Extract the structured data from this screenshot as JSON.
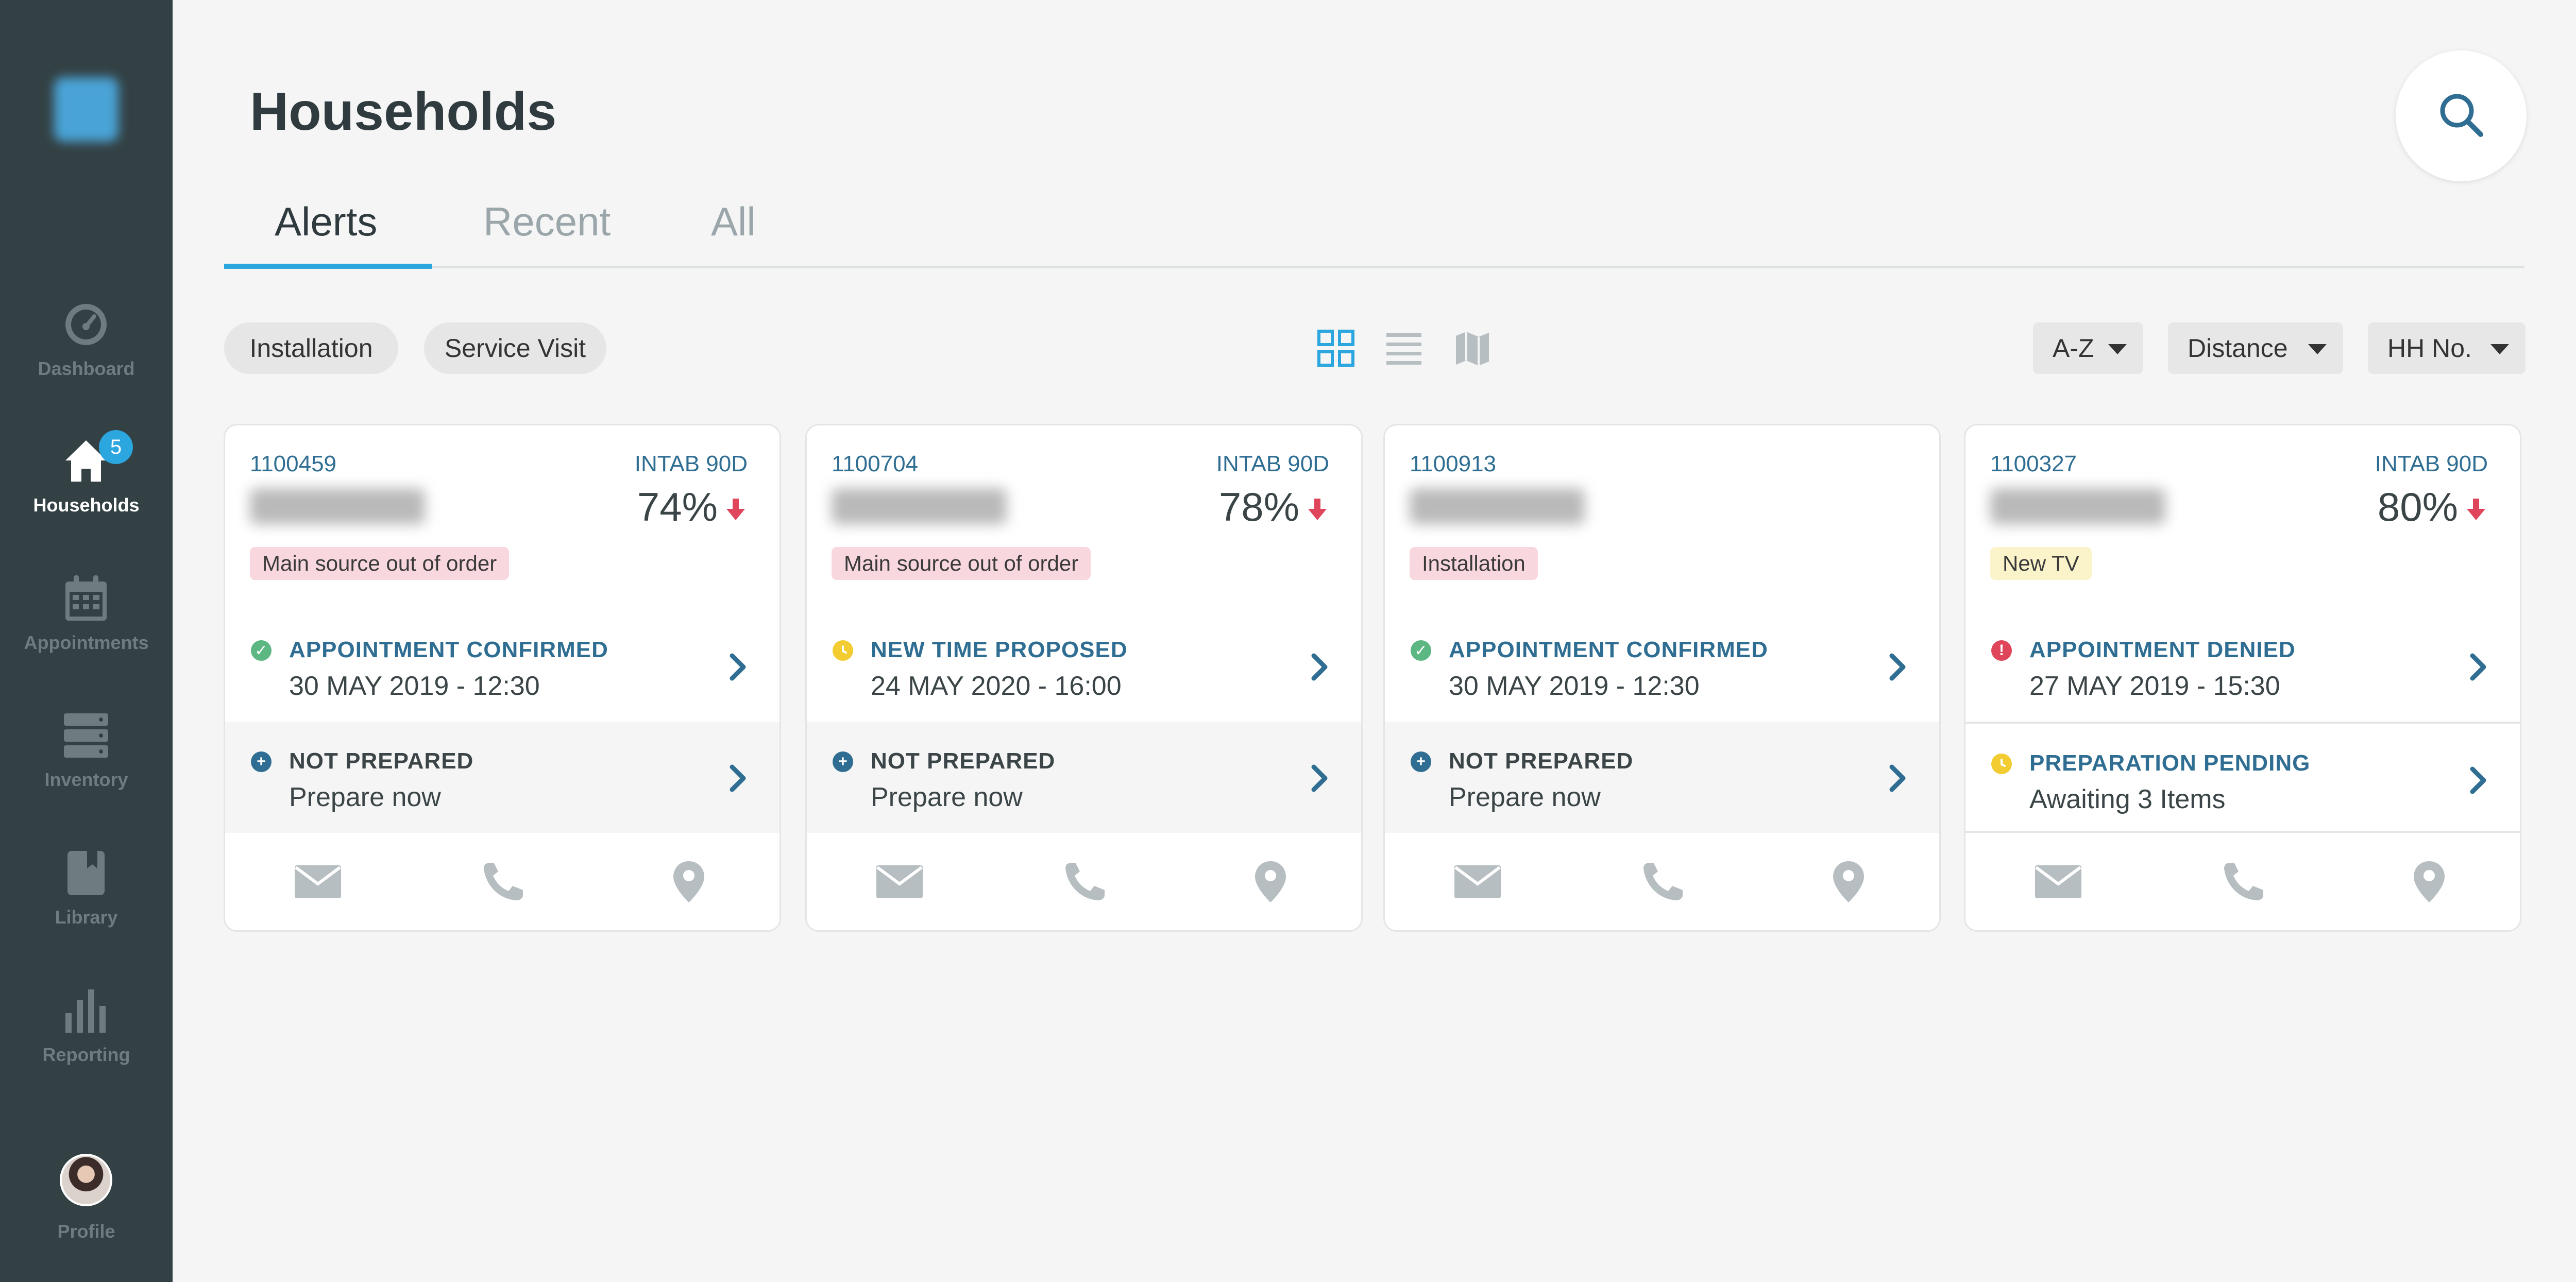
{
  "nav": {
    "items": [
      {
        "label": "Dashboard",
        "icon": "dashboard-icon"
      },
      {
        "label": "Households",
        "icon": "home-icon",
        "badge": "5"
      },
      {
        "label": "Appointments",
        "icon": "calendar-icon"
      },
      {
        "label": "Inventory",
        "icon": "inventory-icon"
      },
      {
        "label": "Library",
        "icon": "book-icon"
      },
      {
        "label": "Reporting",
        "icon": "bar-chart-icon"
      }
    ],
    "profile_label": "Profile"
  },
  "header": {
    "title": "Households"
  },
  "tabs": [
    {
      "label": "Alerts"
    },
    {
      "label": "Recent"
    },
    {
      "label": "All"
    }
  ],
  "filters": {
    "chips": [
      "Installation",
      "Service Visit"
    ],
    "sort": [
      "A-Z",
      "Distance",
      "HH No."
    ]
  },
  "colors": {
    "accent": "#2ba6de",
    "sidebar": "#334144",
    "link_blue": "#2f6e92",
    "confirmed_green": "#5db783",
    "pending_yellow": "#f2cc30",
    "denied_red": "#e0465b",
    "down_arrow": "#e0465b"
  },
  "cards": [
    {
      "id": "1100459",
      "intab": "INTAB 90D",
      "percent": "74%",
      "tag": "Main source out of order",
      "appointment": {
        "status": "APPOINTMENT CONFIRMED",
        "date": "30 MAY 2019 - 12:30"
      },
      "preparation": {
        "status": "NOT PREPARED",
        "detail": "Prepare now"
      }
    },
    {
      "id": "1100704",
      "intab": "INTAB 90D",
      "percent": "78%",
      "tag": "Main source out of order",
      "appointment": {
        "status": "NEW TIME PROPOSED",
        "date": "24 MAY 2020 - 16:00"
      },
      "preparation": {
        "status": "NOT PREPARED",
        "detail": "Prepare now"
      }
    },
    {
      "id": "1100913",
      "tag": "Installation",
      "appointment": {
        "status": "APPOINTMENT CONFIRMED",
        "date": "30 MAY 2019 - 12:30"
      },
      "preparation": {
        "status": "NOT PREPARED",
        "detail": "Prepare now"
      }
    },
    {
      "id": "1100327",
      "intab": "INTAB 90D",
      "percent": "80%",
      "tag": "New TV",
      "appointment": {
        "status": "APPOINTMENT DENIED",
        "date": "27 MAY 2019 - 15:30"
      },
      "preparation": {
        "status": "PREPARATION PENDING",
        "detail": "Awaiting 3 Items"
      }
    }
  ]
}
